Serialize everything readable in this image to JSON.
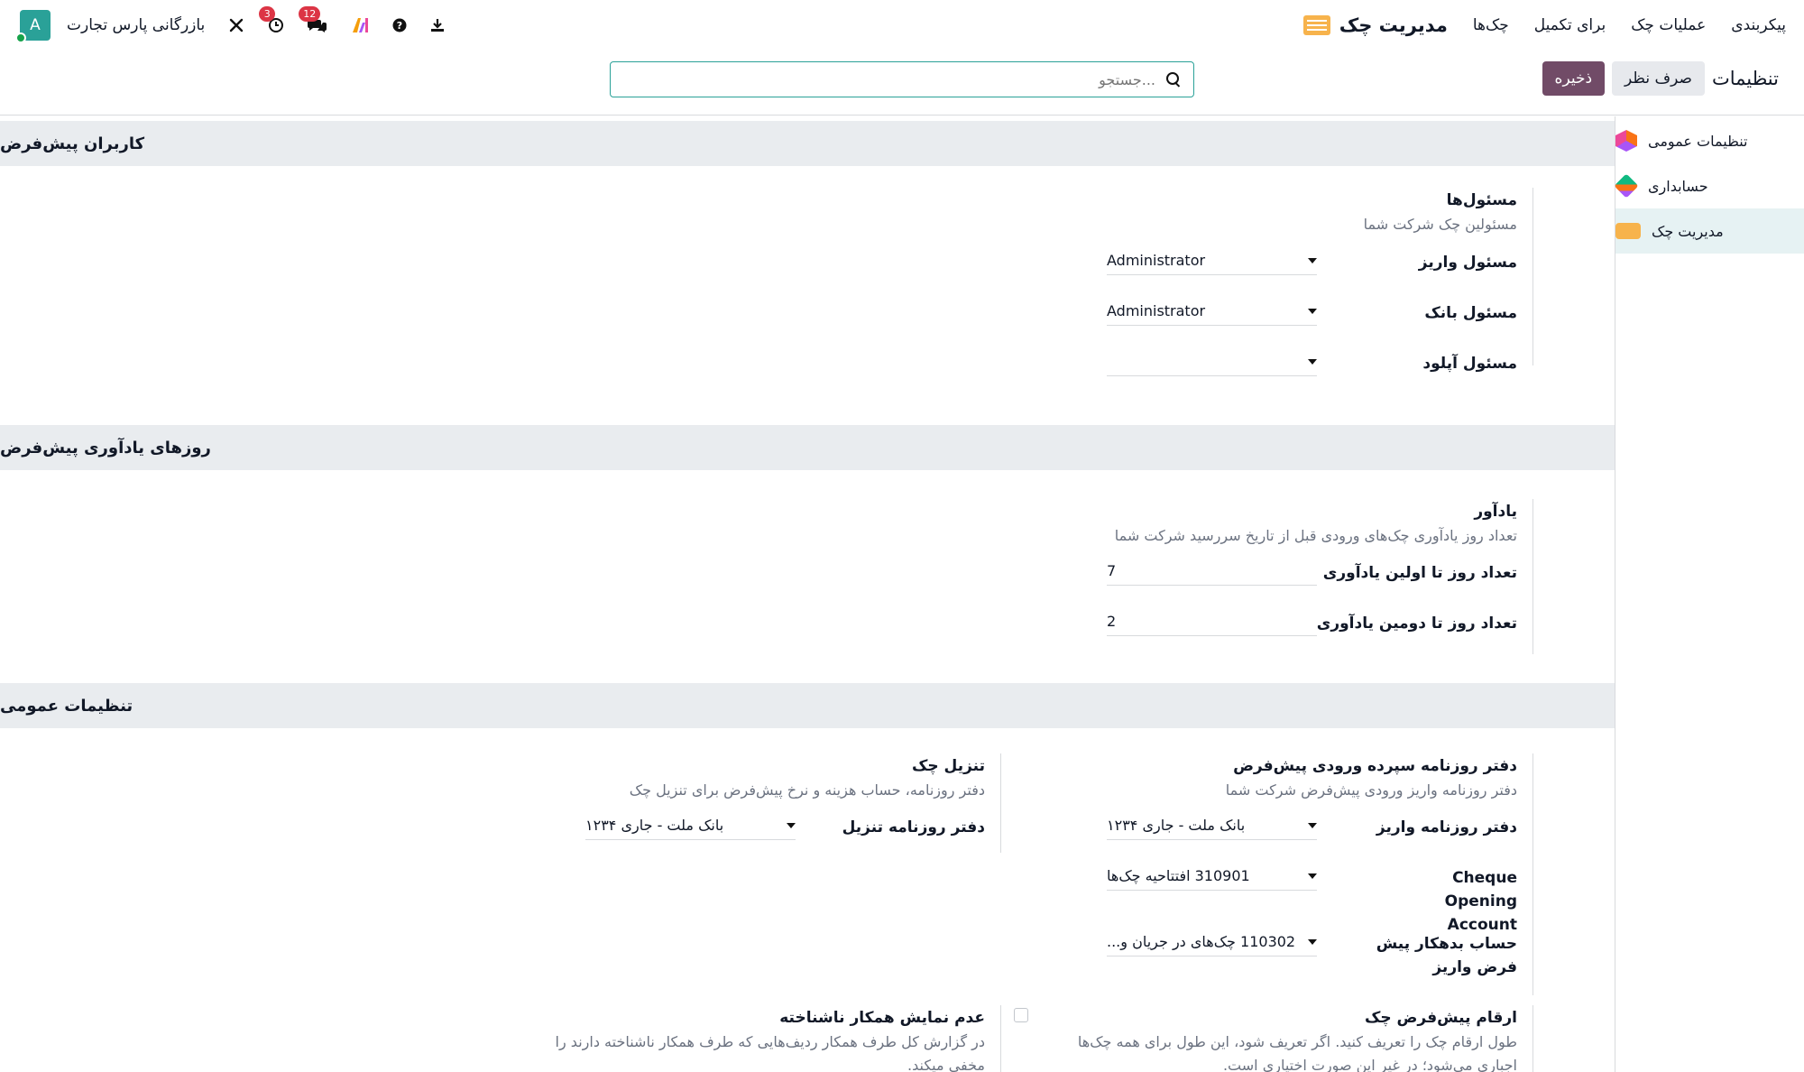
{
  "navbar": {
    "app_name": "مدیریت چک",
    "menu": [
      "چک‌ها",
      "برای تکمیل",
      "عملیات چک",
      "پیکربندی"
    ],
    "company": "بازرگانی پارس تجارت",
    "avatar_letter": "A",
    "activity_count": "3",
    "messages_count": "12",
    "ai_label": "AI"
  },
  "control": {
    "save": "ذخیره",
    "discard": "صرف نظر",
    "title": "تنظیمات",
    "search_placeholder": "جستجو..."
  },
  "sidebar": {
    "items": [
      {
        "label": "تنظیمات عمومی",
        "icon": "general-settings-icon"
      },
      {
        "label": "حسابداری",
        "icon": "accounting-icon"
      },
      {
        "label": "مدیریت چک",
        "icon": "cheque-icon",
        "active": true
      }
    ]
  },
  "sections": {
    "users": {
      "heading": "کاربران پیش‌فرض",
      "title": "مسئول‌ها",
      "desc": "مسئولین چک شرکت شما",
      "fields": [
        {
          "label": "مسئول واریز",
          "value": "Administrator"
        },
        {
          "label": "مسئول بانک",
          "value": "Administrator"
        },
        {
          "label": "مسئول آپلود",
          "value": ""
        }
      ]
    },
    "reminders": {
      "heading": "روزهای یادآوری پیش‌فرض",
      "title": "یادآور",
      "desc": "تعداد روز یادآوری چک‌های ورودی قبل از تاریخ سررسید شرکت شما",
      "fields": [
        {
          "label": "تعداد روز تا اولین یادآوری",
          "value": "7"
        },
        {
          "label": "تعداد روز تا دومین یادآوری",
          "value": "2"
        }
      ]
    },
    "general": {
      "heading": "تنظیمات عمومی",
      "journal_title": "دفتر روزنامه سپرده ورودی پیش‌فرض",
      "journal_desc": "دفتر روزنامه واریز ورودی پیش‌فرض شرکت شما",
      "deposit_journal_label": "دفتر روزنامه واریز",
      "deposit_journal_value": "بانک ملت - جاری ۱۲۳۴",
      "opening_label": "Cheque Opening Account",
      "opening_value": "310901 افتتاحیه چک‌ها",
      "debtor_label": "حساب بدهکار پیش فرض واریز",
      "debtor_value": "110302 چک‌های در جریان و...",
      "discount_title": "تنزیل چک",
      "discount_desc": "دفتر روزنامه، حساب هزینه و نرخ پیش‌فرض برای تنزیل چک",
      "discount_label": "دفتر روزنامه تنزیل",
      "discount_value": "بانک ملت - جاری ۱۲۳۴",
      "digits_title": "ارقام پیش‌فرض چک",
      "digits_desc_1": "طول ارقام چک را تعریف کنید. اگر تعریف شود، این طول برای همه چک‌ها",
      "digits_desc_2": "اجباری می‌شود؛ در غیر این صورت اختیاری است.",
      "unknown_title": "عدم نمایش همکار ناشناخته",
      "unknown_desc_1": "در گزارش کل طرف همکار ردیف‌هایی که طرف همکار ناشناخته دارند را",
      "unknown_desc_2": "مخفی میکند."
    }
  }
}
